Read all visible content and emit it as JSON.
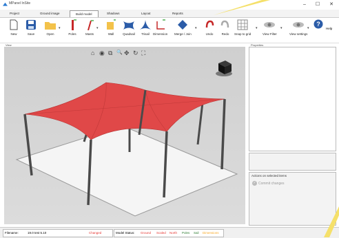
{
  "window": {
    "title": "MPanel InSite",
    "controls": [
      "–",
      "☐",
      "✕"
    ]
  },
  "menu": {
    "tabs": [
      "Project",
      "Ground image",
      "Build model",
      "Shadows",
      "Layout",
      "Reports"
    ],
    "active": "Build model"
  },
  "toolbar": {
    "new": "New",
    "save": "Save",
    "open": "Open",
    "poles": "Poles",
    "masts": "Masts",
    "wall": "Wall",
    "quadsail": "Quadsail",
    "trisail": "Trisail",
    "dimension": "Dimension",
    "merge_join": "Merge / Join",
    "undo": "Undo",
    "redo": "Redo",
    "snap_to_grid": "Snap to grid",
    "view_filter": "View Filter",
    "view_settings": "View settings",
    "help": "Help",
    "caret": "▾"
  },
  "panels": {
    "view_label": "View",
    "properties_label": "Properties",
    "actions_label": "Actions on selected items",
    "commit_label": "Commit changes"
  },
  "viewport_tools": [
    "⌂",
    "◉",
    "⧉",
    "🔍",
    "✥",
    "↻",
    "⛶"
  ],
  "status": {
    "filename_label": "Filename:",
    "filename_value": "19.0 test 5.10",
    "changed": "Changed",
    "model_status_label": "Model Status:",
    "items": [
      {
        "label": "Ground",
        "color": "#e53935"
      },
      {
        "label": "Scaled",
        "color": "#e53935"
      },
      {
        "label": "North",
        "color": "#e53935"
      },
      {
        "label": "Poles",
        "color": "#2e7d32"
      },
      {
        "label": "Sail",
        "color": "#2e7d32"
      },
      {
        "label": "Dimensions",
        "color": "#f9a825"
      }
    ]
  },
  "colors": {
    "accent": "#2b7bd3",
    "sail": "#e04848",
    "changed": "#e53935"
  }
}
